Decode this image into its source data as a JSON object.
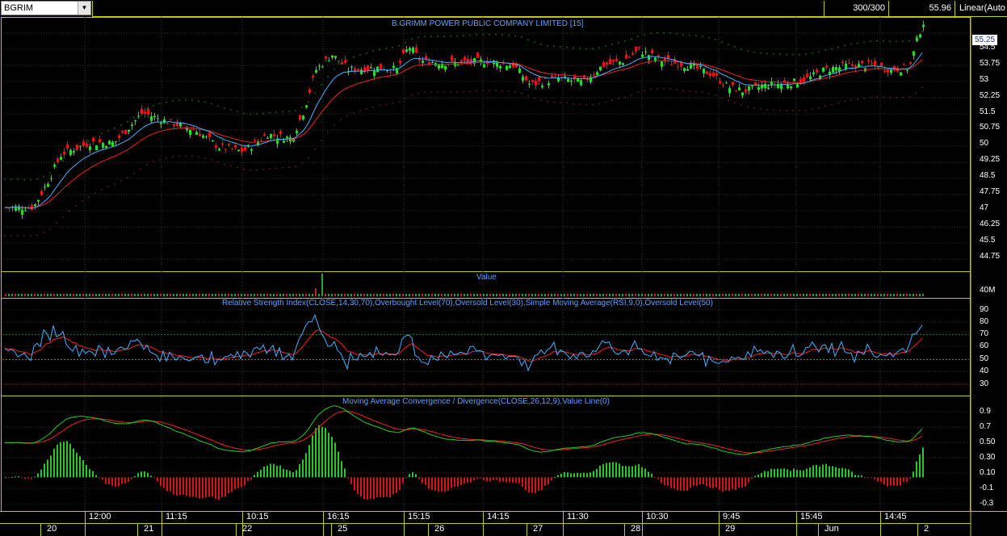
{
  "symbol": "BGRIM",
  "toolbar": {
    "bars": "300/300",
    "last": "55.96",
    "scale": "Linear(Auto"
  },
  "price_panel": {
    "title": "B.GRIMM POWER PUBLIC COMPANY LIMITED [15]",
    "current_price": "55.25",
    "y_ticks": [
      "55.25",
      "54.5",
      "53.75",
      "53",
      "52.25",
      "51.5",
      "50.75",
      "50",
      "49.25",
      "48.5",
      "47.75",
      "47",
      "46.25",
      "45.5",
      "44.75"
    ]
  },
  "volume_panel": {
    "title": "Value",
    "y_ticks": [
      "40M"
    ]
  },
  "rsi_panel": {
    "title": "Relative Strength Index(CLOSE,14,30,70),Overbought Level(70),Oversold Level(30),Simple Moving Average(RSI,9,0),Oversold Level(50)",
    "y_ticks": [
      "90",
      "80",
      "70",
      "60",
      "50",
      "40",
      "30"
    ]
  },
  "macd_panel": {
    "title": "Moving Average Convergence / Divergence(CLOSE,26,12,9),Value Line(0)",
    "y_ticks": [
      "0.9",
      "0.7",
      "0.50",
      "0.30",
      "0.10",
      "-0.1",
      "-0.3"
    ]
  },
  "time_axis": {
    "times": [
      "12:00",
      "11:15",
      "10:15",
      "16:15",
      "15:15",
      "14:15",
      "11:30",
      "10:30",
      "9:45",
      "15:45",
      "14:45"
    ],
    "days": [
      "20",
      "21",
      "22",
      "25",
      "26",
      "27",
      "28",
      "29",
      "Jun",
      "2"
    ]
  },
  "colors": {
    "up": "#22dd22",
    "down": "#ee1111",
    "frame": "#c8c800",
    "title": "#5aa0ff",
    "ema_fast": "#40b0ff",
    "ema_slow": "#ee2222"
  }
}
